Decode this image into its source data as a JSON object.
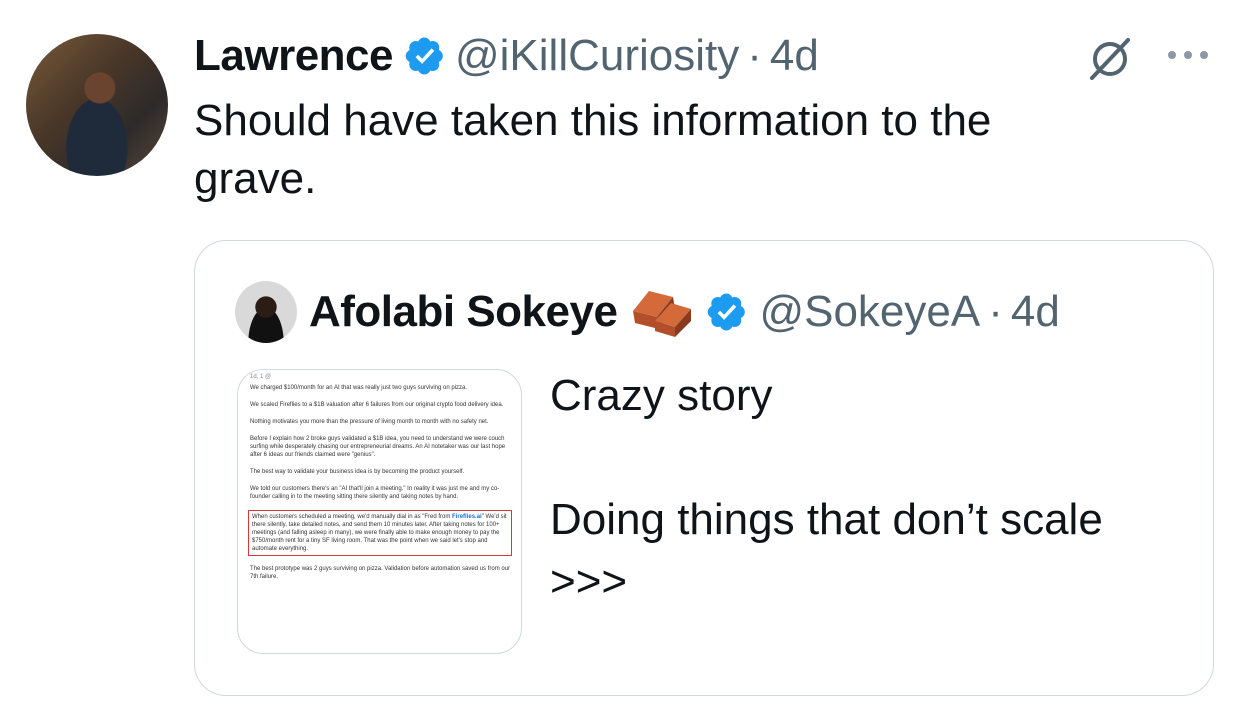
{
  "tweet": {
    "author_name": "Lawrence",
    "handle": "@iKillCuriosity",
    "separator": "·",
    "time": "4d",
    "text_line1": "Should have taken this information to the",
    "text_line2": "grave.",
    "icons": {
      "verified": "verified-badge-icon",
      "grok": "grok-icon",
      "more": "more-icon"
    },
    "colors": {
      "verified": "#1d9bf0",
      "secondary_text": "#536471",
      "border": "#cfd9de"
    }
  },
  "quote": {
    "author_name": "Afolabi Sokeye",
    "handle": "@SokeyeA",
    "separator": "·",
    "time": "4d",
    "text_line1": "Crazy story",
    "text_line2": "Doing things that don’t scale",
    "text_line3": ">>>",
    "media": {
      "top": "1d, 1 @",
      "p1": "We charged $100/month for an AI that was really just two guys surviving on pizza.",
      "p2": "We scaled Fireflies to a $1B valuation after 6 failures from our original crypto food delivery idea.",
      "p3": "Nothing motivates you more than the pressure of living month to month with no safety net.",
      "p4": "Before I explain how 2 broke guys validated a $1B idea, you need to understand we were couch surfing while desperately chasing our entrepreneurial dreams. An AI notetaker was our last hope after 6 ideas our friends claimed were \"genius\".",
      "p5": "The best way to validate your business idea is by becoming the product yourself.",
      "p6": "We told our customers there's an \"AI that'll join a meeting.\" In reality it was just me and my co-founder calling in to the meeting sitting there silently and taking notes by hand.",
      "p7a": "When customers scheduled a meeting, we'd manually dial in as \"Fred from ",
      "p7_link": "Fireflies.ai",
      "p7b": "\" We'd sit there silently, take detailed notes, and send them 10 minutes later. After taking notes for 100+ meetings (and falling asleep in many), we were finally able to make enough money to pay the $750/month rent for a tiny SF living room. That was the point when we said let's stop and automate everything.",
      "p8": "The best prototype was 2 guys surviving on pizza. Validation before automation saved us from our 7th failure."
    }
  }
}
